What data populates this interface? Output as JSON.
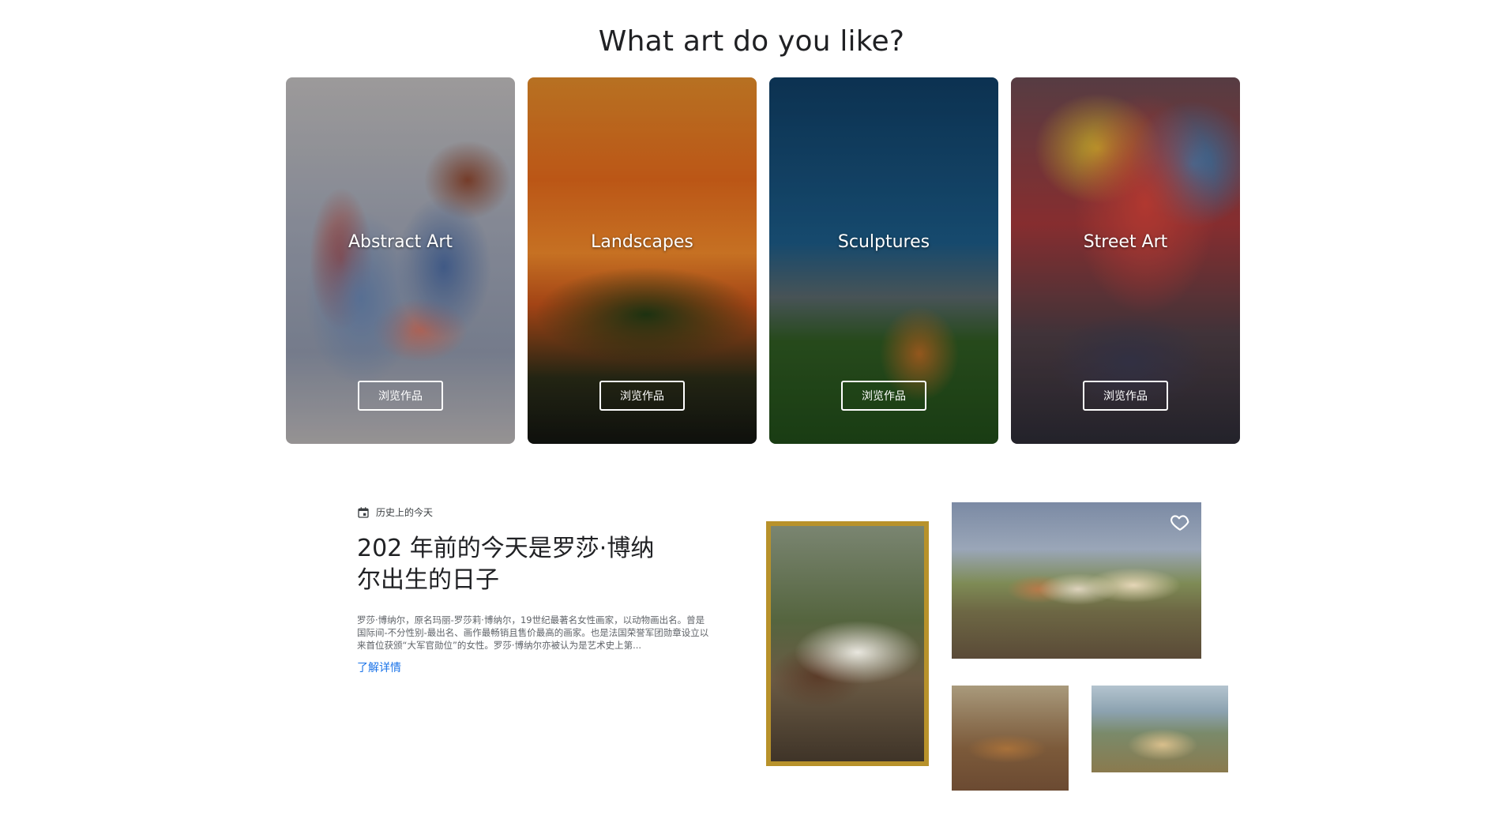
{
  "heading": "What art do you like?",
  "categories": [
    {
      "title": "Abstract Art",
      "button": "浏览作品"
    },
    {
      "title": "Landscapes",
      "button": "浏览作品"
    },
    {
      "title": "Sculptures",
      "button": "浏览作品"
    },
    {
      "title": "Street Art",
      "button": "浏览作品"
    }
  ],
  "on_this_day": {
    "icon": "calendar-icon",
    "kicker": "历史上的今天",
    "title": "202 年前的今天是罗莎·博纳尔出生的日子",
    "description": "罗莎·博纳尔，原名玛丽-罗莎莉·博纳尔，19世纪最著名女性画家，以动物画出名。曾是国际间-不分性别-最出名、画作最畅销且售价最高的画家。也是法国荣誉军团勋章设立以来首位获颁“大军官勋位”的女性。罗莎·博纳尔亦被认为是艺术史上第...",
    "link": "了解详情"
  },
  "artworks": {
    "favorite_icon": "heart-outline-icon"
  }
}
